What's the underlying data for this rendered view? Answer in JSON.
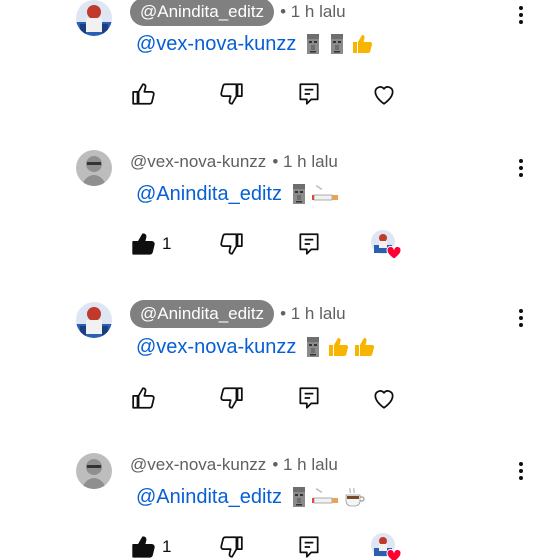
{
  "comments": [
    {
      "author": "@Anindita_editz",
      "author_style": "pill",
      "avatar": "photo-avatar",
      "time": "• 1 h lalu",
      "mention": "@vex-nova-kunzz",
      "emojis": [
        "moai",
        "moai",
        "thumbs-up"
      ],
      "liked": false,
      "like_count": "",
      "creator_heart": false
    },
    {
      "author": "@vex-nova-kunzz",
      "author_style": "plain",
      "avatar": "grey-avatar",
      "time": "• 1 h lalu",
      "mention": "@Anindita_editz",
      "emojis": [
        "moai",
        "cigarette"
      ],
      "liked": true,
      "like_count": "1",
      "creator_heart": true
    },
    {
      "author": "@Anindita_editz",
      "author_style": "pill",
      "avatar": "photo-avatar",
      "time": "• 1 h lalu",
      "mention": "@vex-nova-kunzz",
      "emojis": [
        "moai",
        "thumbs-up",
        "thumbs-up"
      ],
      "liked": false,
      "like_count": "",
      "creator_heart": false
    },
    {
      "author": "@vex-nova-kunzz",
      "author_style": "plain",
      "avatar": "grey-avatar",
      "time": "• 1 h lalu",
      "mention": "@Anindita_editz",
      "emojis": [
        "moai",
        "cigarette",
        "coffee"
      ],
      "liked": true,
      "like_count": "1",
      "creator_heart": true
    }
  ],
  "colors": {
    "mention": "#065fd4",
    "pill_bg": "#808080",
    "meta": "#606060",
    "heart": "#ff0033"
  }
}
